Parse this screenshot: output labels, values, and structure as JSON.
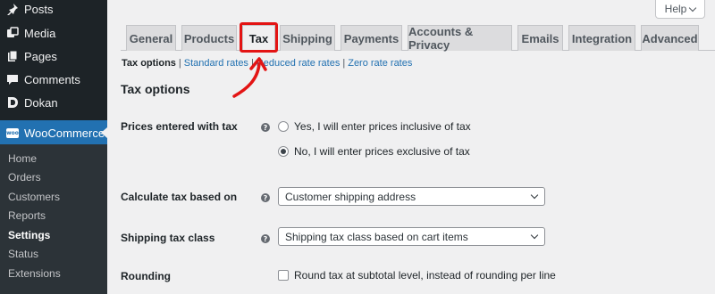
{
  "sidebar": {
    "items": [
      {
        "label": "Posts",
        "icon": "pin-icon"
      },
      {
        "label": "Media",
        "icon": "media-icon"
      },
      {
        "label": "Pages",
        "icon": "pages-icon"
      },
      {
        "label": "Comments",
        "icon": "comments-icon"
      },
      {
        "label": "Dokan",
        "icon": "dokan-icon"
      }
    ],
    "woocommerce": {
      "label": "WooCommerce",
      "badge": "woo"
    },
    "submenu": [
      "Home",
      "Orders",
      "Customers",
      "Reports",
      "Settings",
      "Status",
      "Extensions"
    ],
    "current_submenu": "Settings"
  },
  "help": {
    "label": "Help"
  },
  "tabs": [
    "General",
    "Products",
    "Tax",
    "Shipping",
    "Payments",
    "Accounts & Privacy",
    "Emails",
    "Integration",
    "Advanced"
  ],
  "active_tab": "Tax",
  "subnav": {
    "current": "Tax options",
    "links": [
      "Standard rates",
      "Reduced rate rates",
      "Zero rate rates"
    ],
    "separator": "|"
  },
  "section_title": "Tax options",
  "fields": {
    "prices_entered": {
      "label": "Prices entered with tax",
      "options": [
        "Yes, I will enter prices inclusive of tax",
        "No, I will enter prices exclusive of tax"
      ],
      "selected_index": 1
    },
    "calculate_based_on": {
      "label": "Calculate tax based on",
      "value": "Customer shipping address"
    },
    "shipping_tax_class": {
      "label": "Shipping tax class",
      "value": "Shipping tax class based on cart items"
    },
    "rounding": {
      "label": "Rounding",
      "checkbox_label": "Round tax at subtotal level, instead of rounding per line",
      "checked": false
    }
  },
  "colors": {
    "sidebar_bg": "#1d2327",
    "accent": "#2271b1",
    "highlight": "#e31414",
    "page_bg": "#f0f0f1"
  }
}
